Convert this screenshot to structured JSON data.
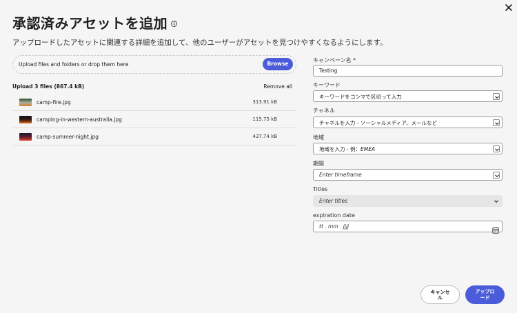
{
  "dialog": {
    "title": "承認済みアセットを追加",
    "info_icon": "info-icon",
    "subtitle": "アップロードしたアセットに関連する詳細を追加して、他のユーザーがアセットを見つけやすくなるようにします。",
    "close_icon": "close-icon"
  },
  "upload": {
    "dropzone_text": "Upload files and folders or drop them here",
    "browse_label": "Browse",
    "count_label": "Upload 3 files (867.4 kB)",
    "remove_all_label": "Remove all",
    "files": [
      {
        "name": "camp-fire.jpg",
        "size": "313.91 kB",
        "thumb_colors": [
          "#2f4a2a",
          "#a8b2a0",
          "#e07a1f"
        ]
      },
      {
        "name": "camping-in-western-australia.jpg",
        "size": "115.75 kB",
        "thumb_colors": [
          "#111018",
          "#3a1c10",
          "#e46d1b"
        ]
      },
      {
        "name": "camp-summer-night.jpg",
        "size": "437.74 kB",
        "thumb_colors": [
          "#151833",
          "#6b1f2f",
          "#e0462a"
        ]
      }
    ]
  },
  "form": {
    "campaign": {
      "label": "キャンペーン名",
      "required": "*",
      "value": "Testing"
    },
    "keywords": {
      "label": "キーワード",
      "value": "キーワードをコンマで区切って入力"
    },
    "channel": {
      "label": "チャネル",
      "value": "チャネルを入力 - ソーシャルメディア、メールなど"
    },
    "region": {
      "label": "地域",
      "value_prefix": "地域を入力 - 例：",
      "value_example": "EMEA"
    },
    "period": {
      "label": "期間",
      "placeholder": "Enter timeframe"
    },
    "titles": {
      "label": "Titles",
      "placeholder": "Enter titles"
    },
    "expiration": {
      "label": "expiration date",
      "placeholder": "tt . mm . jjjj"
    }
  },
  "actions": {
    "cancel_label_1": "キャンセ",
    "cancel_label_2": "ル",
    "upload_label_1": "アップロ",
    "upload_label_2": "ード"
  },
  "colors": {
    "accent": "#4b5cdb",
    "background": "#f5f5f5"
  }
}
